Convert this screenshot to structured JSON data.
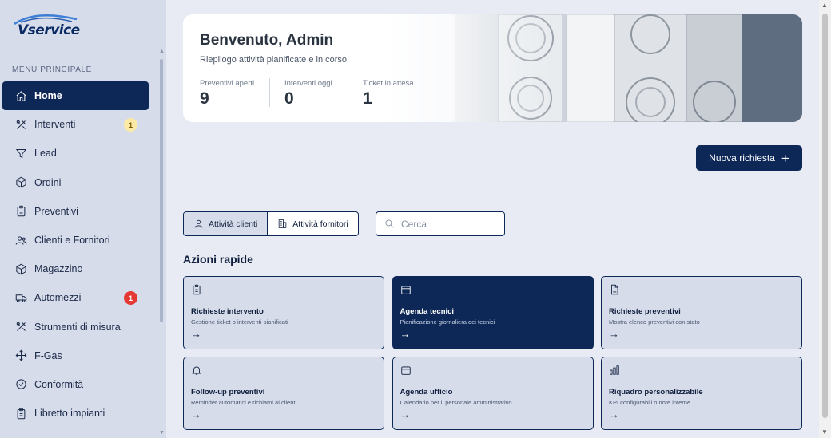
{
  "brand": {
    "logo_text": "Vservice"
  },
  "sidebar": {
    "menu_title": "MENU PRINCIPALE",
    "items": [
      {
        "label": "Home",
        "icon": "home-icon",
        "active": true
      },
      {
        "label": "Interventi",
        "icon": "tools-icon",
        "badge": "1",
        "badge_color": "#fbe9a6"
      },
      {
        "label": "Lead",
        "icon": "filter-icon"
      },
      {
        "label": "Ordini",
        "icon": "box-icon"
      },
      {
        "label": "Preventivi",
        "icon": "clipboard-icon"
      },
      {
        "label": "Clienti e Fornitori",
        "icon": "users-icon"
      },
      {
        "label": "Magazzino",
        "icon": "package-icon"
      },
      {
        "label": "Automezzi",
        "icon": "truck-icon",
        "badge": "1",
        "badge_color": "#e53935"
      },
      {
        "label": "Strumenti di misura",
        "icon": "tools-icon"
      },
      {
        "label": "F-Gas",
        "icon": "move-icon"
      },
      {
        "label": "Conformità",
        "icon": "check-circle-icon"
      },
      {
        "label": "Libretto impianti",
        "icon": "clipboard-icon"
      }
    ]
  },
  "hero": {
    "title": "Benvenuto, Admin",
    "subtitle": "Riepilogo attività pianificate e in corso.",
    "stats": [
      {
        "label": "Preventivi aperti",
        "value": "9"
      },
      {
        "label": "Interventi oggi",
        "value": "0"
      },
      {
        "label": "Ticket in attesa",
        "value": "1"
      }
    ]
  },
  "actions": {
    "new_request": "Nuova richiesta"
  },
  "filters": {
    "tabs": [
      {
        "label": "Attività clienti",
        "icon": "user-icon",
        "active": true
      },
      {
        "label": "Attività fornitori",
        "icon": "building-icon",
        "active": false
      }
    ],
    "search_placeholder": "Cerca"
  },
  "quick": {
    "title": "Azioni rapide",
    "cards": [
      {
        "title": "Richieste intervento",
        "desc": "Gestione ticket o interventi pianificati",
        "icon": "clipboard-icon",
        "dark": false
      },
      {
        "title": "Agenda tecnici",
        "desc": "Pianificazione giornaliera dei tecnici",
        "icon": "calendar-icon",
        "dark": true
      },
      {
        "title": "Richieste preventivi",
        "desc": "Mostra elenco preventivi con stato",
        "icon": "document-icon",
        "dark": false
      },
      {
        "title": "Follow-up preventivi",
        "desc": "Reminder automatici e richiami ai clienti",
        "icon": "bell-icon",
        "dark": false
      },
      {
        "title": "Agenda ufficio",
        "desc": "Calendario per il personale amministrativo",
        "icon": "calendar-icon",
        "dark": false
      },
      {
        "title": "Riquadro personalizzabile",
        "desc": "KPI configurabili o note interne",
        "icon": "bar-chart-icon",
        "dark": false
      }
    ],
    "arrow": "→"
  },
  "colors": {
    "primary": "#0d2757",
    "sidebar_bg": "#d6dcea",
    "page_bg": "#e8ebf3"
  }
}
